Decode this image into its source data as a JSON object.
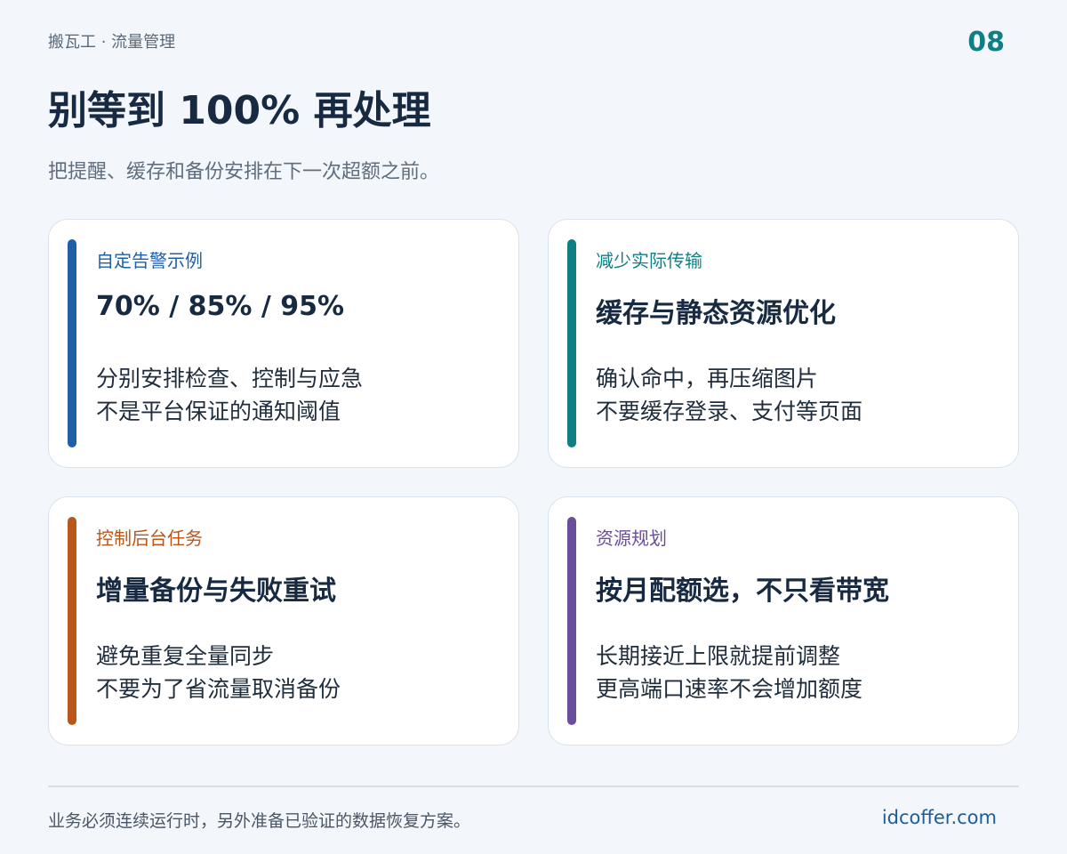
{
  "header": {
    "brand": "搬瓦工 · 流量管理",
    "page_number": "08"
  },
  "title": "别等到 100% 再处理",
  "subtitle": "把提醒、缓存和备份安排在下一次超额之前。",
  "cards": [
    {
      "tag": "自定告警示例",
      "heading": "70% / 85% / 95%",
      "lines": [
        "分别安排检查、控制与应急",
        "不是平台保证的通知阈值"
      ],
      "accent": "#1f5fa6"
    },
    {
      "tag": "减少实际传输",
      "heading": "缓存与静态资源优化",
      "lines": [
        "确认命中，再压缩图片",
        "不要缓存登录、支付等页面"
      ],
      "accent": "#0f7f86"
    },
    {
      "tag": "控制后台任务",
      "heading": "增量备份与失败重试",
      "lines": [
        "避免重复全量同步",
        "不要为了省流量取消备份"
      ],
      "accent": "#b9561a"
    },
    {
      "tag": "资源规划",
      "heading": "按月配额选，不只看带宽",
      "lines": [
        "长期接近上限就提前调整",
        "更高端口速率不会增加额度"
      ],
      "accent": "#6a4e9c"
    }
  ],
  "footer": {
    "note": "业务必须连续运行时，另外准备已验证的数据恢复方案。",
    "site": "idcoffer.com"
  }
}
